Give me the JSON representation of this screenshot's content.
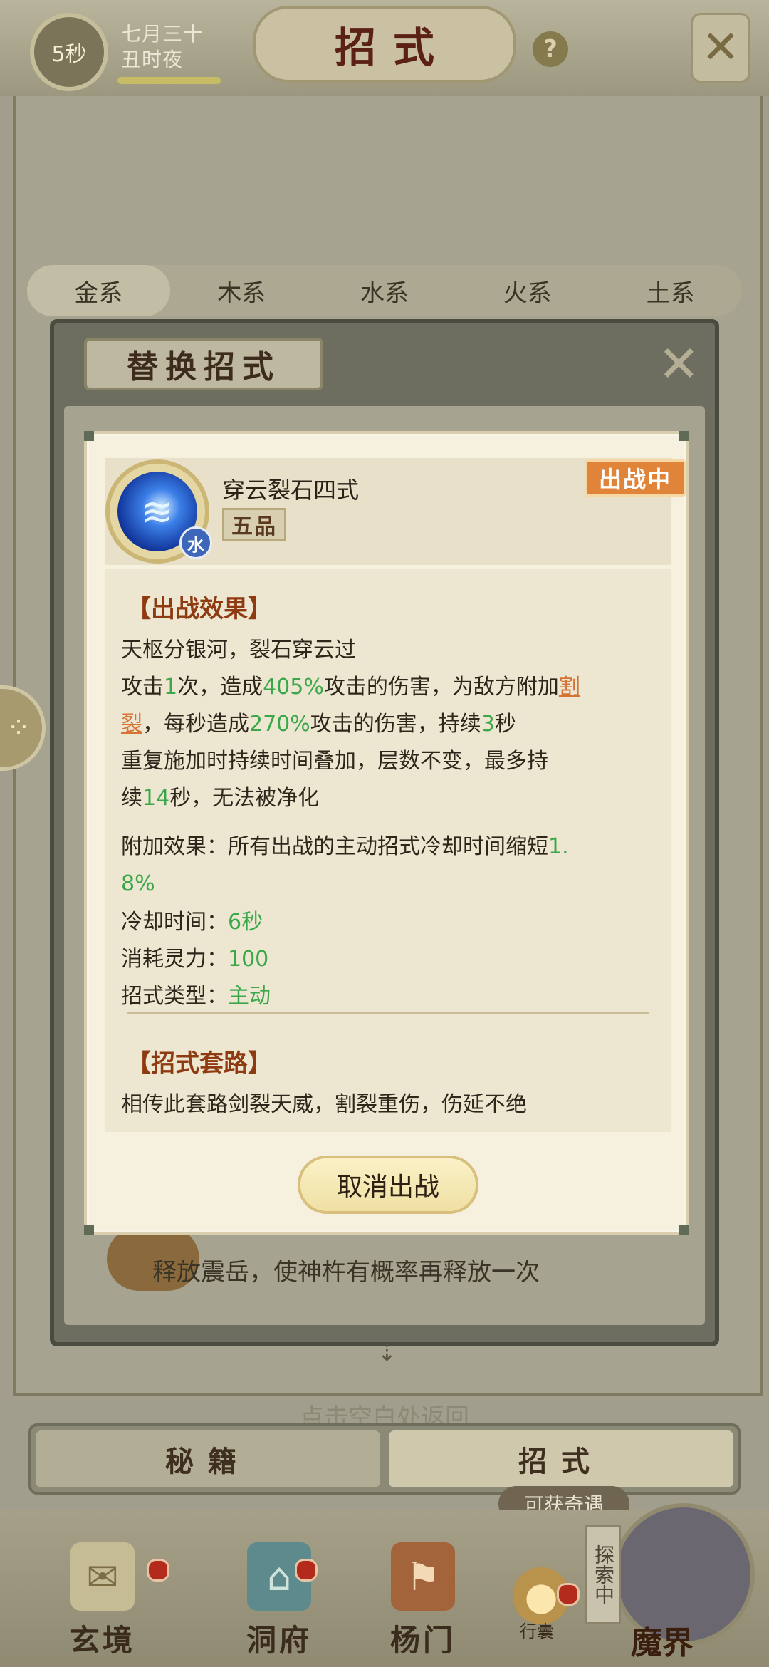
{
  "status_bar": {
    "timer": "5秒",
    "date_line1": "七月三十",
    "date_line2": "丑时夜"
  },
  "page": {
    "title": "招式",
    "help_symbol": "?",
    "close_symbol": "✕"
  },
  "filter_tabs": [
    "金系",
    "木系",
    "水系",
    "火系",
    "土系"
  ],
  "replace_dialog": {
    "title": "替换招式",
    "close_symbol": "✕",
    "behind_row_text": "释放震岳，使神杵有概率再释放一次"
  },
  "skill": {
    "name": "穿云裂石四式",
    "grade": "五品",
    "element": "水",
    "status": "出战中",
    "effect_heading": "【出战效果】",
    "effect_line1": "天枢分银河，裂石穿云过",
    "effect_p2_a": "攻击",
    "effect_p2_hits": "1",
    "effect_p2_b": "次，造成",
    "effect_p2_dmg": "405%",
    "effect_p2_c": "攻击的伤害，为敌方附加",
    "effect_p2_link1": "割",
    "effect_p2_link2": "裂",
    "effect_p2_d": "，每秒造成",
    "effect_p2_dot": "270%",
    "effect_p2_e": "攻击的伤害，持续",
    "effect_p2_dur": "3",
    "effect_p2_f": "秒",
    "effect_p3_a": "重复施加时持续时间叠加，层数不变，最多持",
    "effect_p3_b": "续",
    "effect_p3_max": "14",
    "effect_p3_c": "秒，无法被净化",
    "extra_label": "附加效果：所有出战的主动招式冷却时间缩短",
    "extra_value_a": "1.",
    "extra_value_b": "8%",
    "cooldown_label": "冷却时间：",
    "cooldown_value": "6秒",
    "cost_label": "消耗灵力：",
    "cost_value": "100",
    "type_label": "招式类型：",
    "type_value": "主动",
    "routine_heading": "【招式套路】",
    "routine_text": "相传此套路剑裂天威，割裂重伤，伤延不绝",
    "cancel_button": "取消出战"
  },
  "hint_text": "点击空白处返回",
  "bottom_tabs": [
    "秘籍",
    "招式"
  ],
  "explore_badge": "可获奇遇",
  "nav": {
    "items": [
      "玄境",
      "洞府",
      "杨门"
    ],
    "bag_label": "行囊",
    "explore_tag": "探索中",
    "boss_label": "魔界"
  },
  "colors": {
    "accent_green": "#3aa84a",
    "link_orange": "#d77235",
    "status_orange": "#e0843a",
    "heading_brown": "#8e3b12"
  }
}
